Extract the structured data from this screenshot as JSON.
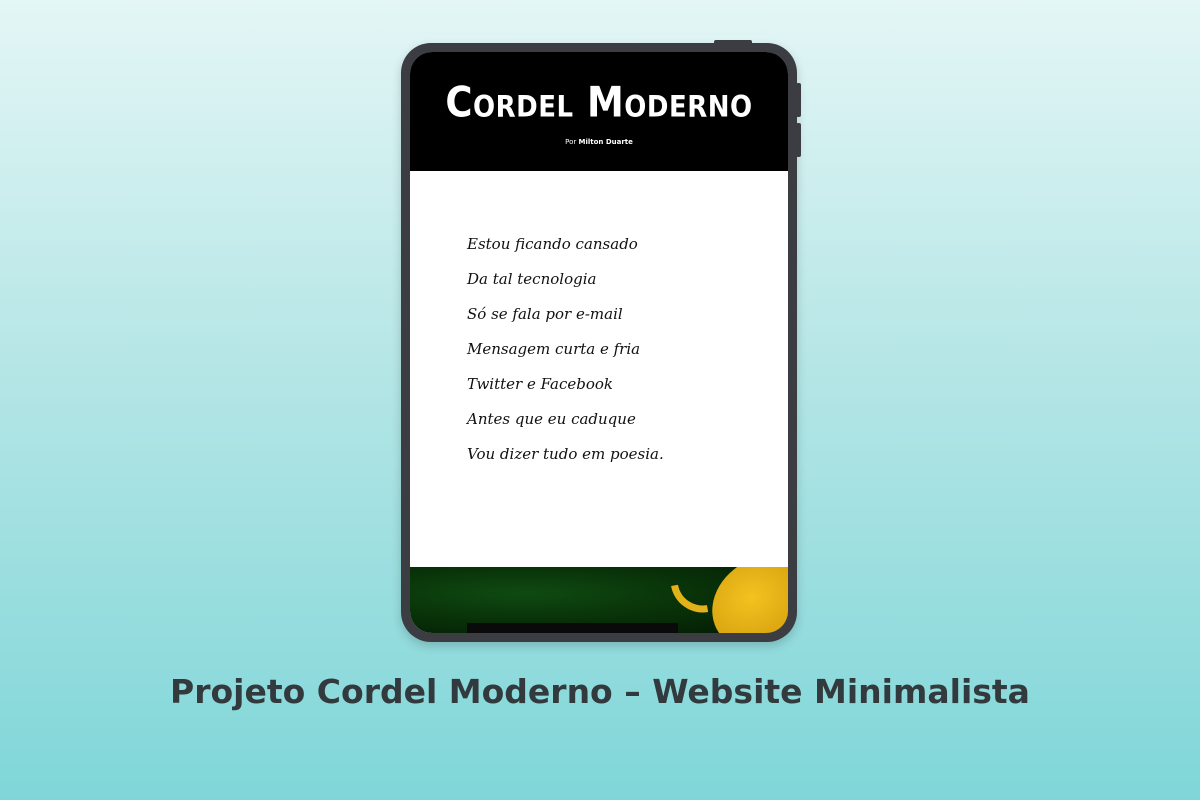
{
  "site": {
    "title": "Cordel Moderno",
    "byline_prefix": "Por",
    "byline_author": "Milton Duarte"
  },
  "poem": {
    "lines": [
      "Estou ficando cansado",
      "Da tal tecnologia",
      "Só se fala por e-mail",
      "Mensagem curta e fria",
      "Twitter e Facebook",
      "Antes que eu caduque",
      "Vou dizer tudo em poesia."
    ]
  },
  "caption": "Projeto Cordel Moderno – Website Minimalista",
  "colors": {
    "header_background": "#000000",
    "page_background": "#ffffff",
    "device_frame": "#3b3d42",
    "backdrop_top": "#e4f6f6",
    "backdrop_bottom": "#7fd6d8",
    "caption_text": "#333a3d"
  }
}
